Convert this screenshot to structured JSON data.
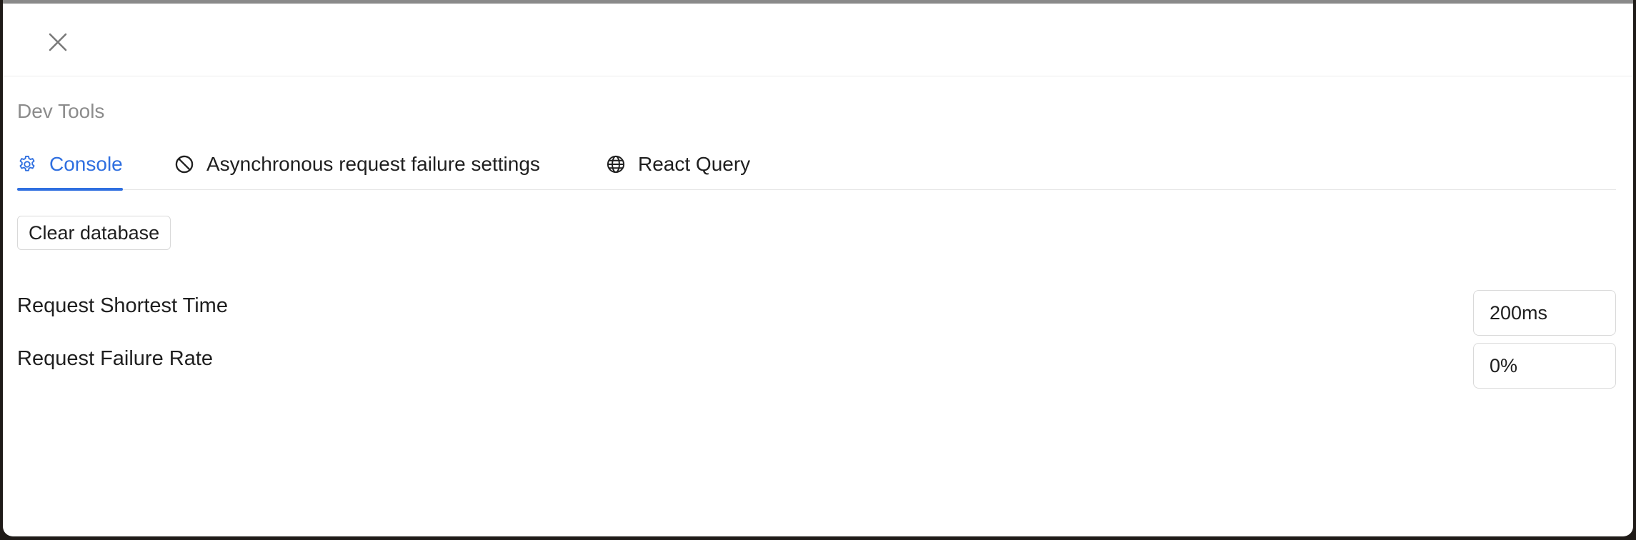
{
  "dialog": {
    "close_icon": "close-icon"
  },
  "section": {
    "title": "Dev Tools"
  },
  "tabs": [
    {
      "label": "Console",
      "icon": "gear-icon",
      "active": true
    },
    {
      "label": "Asynchronous request failure settings",
      "icon": "ban-icon",
      "active": false
    },
    {
      "label": "React Query",
      "icon": "globe-icon",
      "active": false
    }
  ],
  "console": {
    "clear_button_label": "Clear database",
    "settings": [
      {
        "label": "Request Shortest Time",
        "value": "200ms"
      },
      {
        "label": "Request Failure Rate",
        "value": "0%"
      }
    ]
  },
  "colors": {
    "accent": "#2f6fe0",
    "text": "#1f1f1f",
    "muted": "#8c8c8c",
    "border": "#d9d9d9"
  }
}
